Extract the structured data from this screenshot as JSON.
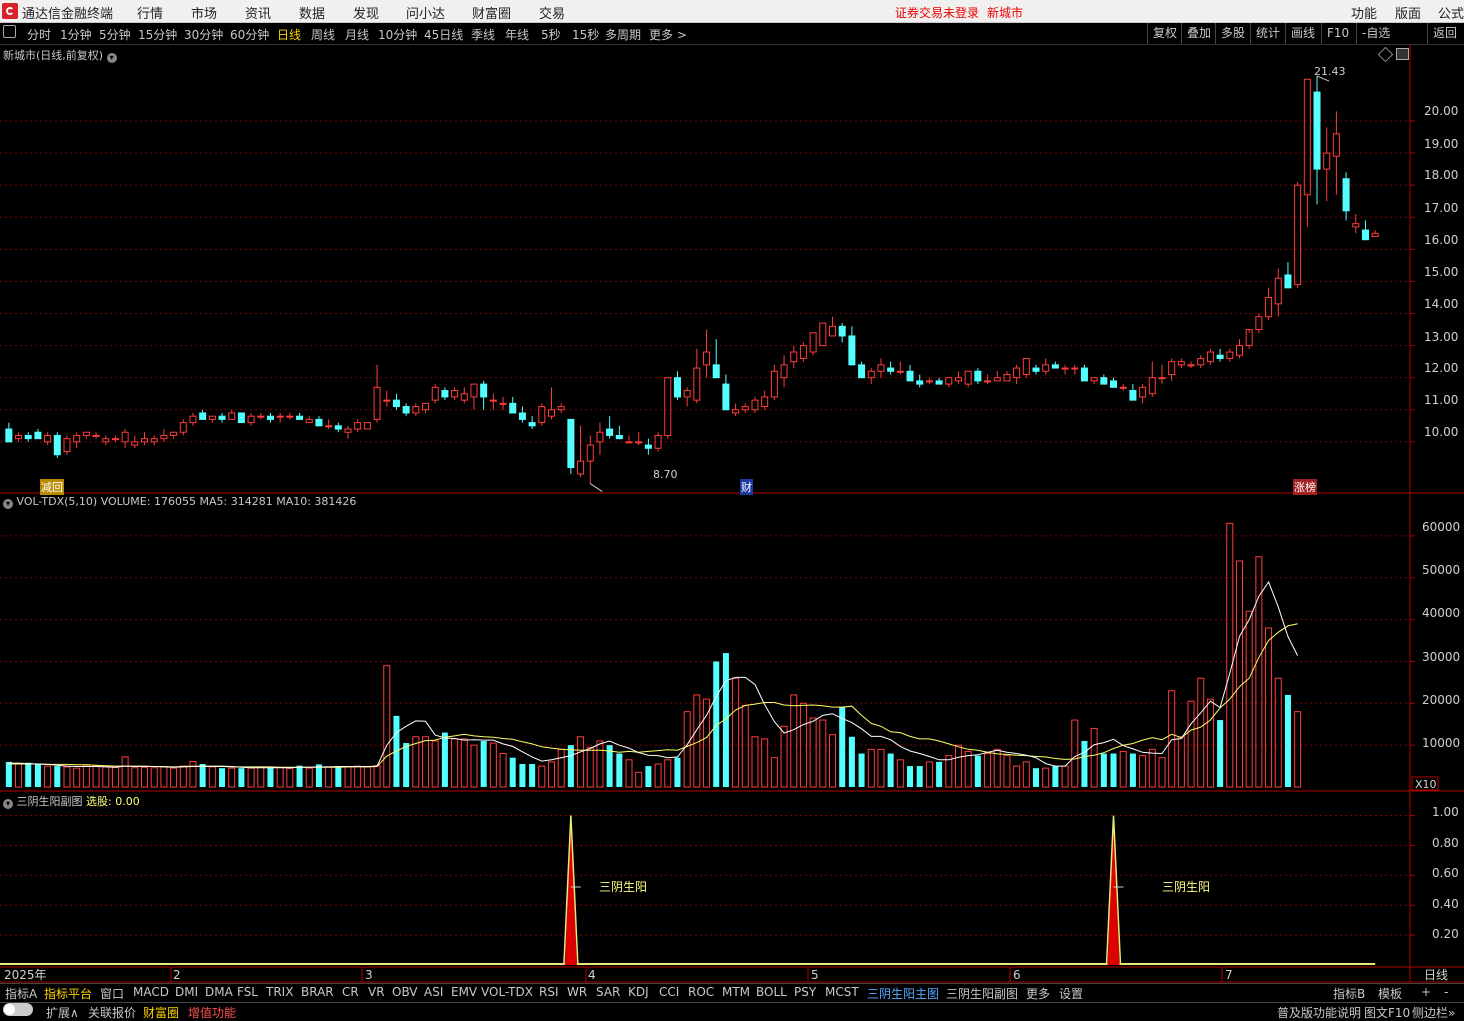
{
  "app": {
    "name": "通达信金融终端",
    "menu": [
      "行情",
      "市场",
      "资讯",
      "数据",
      "发现",
      "问小达",
      "财富圈",
      "交易"
    ],
    "warning": "证券交易未登录",
    "stock_link": "新城市",
    "right_menu": [
      "功能",
      "版面",
      "公式"
    ]
  },
  "periods": [
    "分时",
    "1分钟",
    "5分钟",
    "15分钟",
    "30分钟",
    "60分钟",
    "日线",
    "周线",
    "月线",
    "10分钟",
    "45日线",
    "季线",
    "年线",
    "5秒",
    "15秒",
    "多周期",
    "更多 >"
  ],
  "active_period": "日线",
  "toolbar_right": [
    "复权",
    "叠加",
    "多股",
    "统计",
    "画线",
    "F10",
    "-自选",
    "返回"
  ],
  "main_panel": {
    "title": "新城市(日线,前复权)",
    "high_label": "21.43",
    "low_label": "8.70",
    "tags": [
      "减回",
      "财",
      "涨榜"
    ],
    "y_ticks": [
      "20.00",
      "19.00",
      "18.00",
      "17.00",
      "16.00",
      "15.00",
      "14.00",
      "13.00",
      "12.00",
      "11.00",
      "10.00"
    ]
  },
  "volume_panel": {
    "title": "VOL-TDX(5,10)",
    "volume_label": "VOLUME:",
    "volume": "176055",
    "ma5_label": "MA5:",
    "ma5": "314281",
    "ma10_label": "MA10:",
    "ma10": "381426",
    "y_ticks": [
      "60000",
      "50000",
      "40000",
      "30000",
      "20000",
      "10000"
    ],
    "unit": "X10"
  },
  "indicator_panel": {
    "title": "三阴生阳副图",
    "select_label": "选股:",
    "select_value": "0.00",
    "signal_label": "三阴生阳",
    "y_ticks": [
      "1.00",
      "0.80",
      "0.60",
      "0.40",
      "0.20"
    ]
  },
  "x_axis": {
    "labels": [
      "2025年",
      "2",
      "3",
      "4",
      "5",
      "6",
      "7"
    ],
    "period_label": "日线"
  },
  "indicator_tabs": [
    "指标A",
    "指标平台",
    "窗口",
    "MACD",
    "DMI",
    "DMA",
    "FSL",
    "TRIX",
    "BRAR",
    "CR",
    "VR",
    "OBV",
    "ASI",
    "EMV",
    "VOL-TDX",
    "RSI",
    "WR",
    "SAR",
    "KDJ",
    "CCI",
    "ROC",
    "MTM",
    "BOLL",
    "PSY",
    "MCST",
    "三阴生阳主图",
    "三阴生阳副图",
    "更多",
    "设置"
  ],
  "indicator_tabs_right": [
    "指标B",
    "模板",
    "+",
    "-"
  ],
  "status": {
    "items": [
      "扩展∧",
      "关联报价",
      "财富圈",
      "增值功能"
    ],
    "right": [
      "普及版功能说明",
      "图文F10",
      "侧边栏»"
    ]
  },
  "colors": {
    "up": "#ff3c3c",
    "down": "#54ffff",
    "grid": "#7a0000",
    "axis": "#b00000",
    "ma5": "#ffffff",
    "ma10": "#ffff66",
    "signal": "#e8e87a",
    "active_text": "#ffd200"
  },
  "chart_data": {
    "type": "candlestick",
    "price_range": [
      8.5,
      21.9
    ],
    "volume_range": [
      0,
      65000
    ],
    "signal_range": [
      0,
      1.05
    ],
    "candles": [
      [
        10.4,
        10.6,
        10.2,
        10.0
      ],
      [
        10.1,
        10.3,
        10.0,
        10.2
      ],
      [
        10.2,
        10.3,
        10.0,
        10.1
      ],
      [
        10.3,
        10.4,
        10.1,
        10.1
      ],
      [
        10.0,
        10.3,
        9.9,
        10.2
      ],
      [
        10.2,
        10.3,
        9.5,
        9.6
      ],
      [
        9.7,
        10.2,
        9.6,
        10.1
      ],
      [
        10.0,
        10.3,
        9.8,
        10.2
      ],
      [
        10.2,
        10.3,
        10.1,
        10.3
      ],
      [
        10.2,
        10.3,
        10.1,
        10.2
      ],
      [
        10.0,
        10.2,
        9.9,
        10.1
      ],
      [
        10.1,
        10.2,
        10.0,
        10.1
      ],
      [
        10.0,
        10.4,
        9.8,
        10.3
      ],
      [
        9.9,
        10.2,
        9.8,
        10.0
      ],
      [
        10.0,
        10.3,
        9.9,
        10.1
      ],
      [
        10.0,
        10.2,
        9.9,
        10.1
      ],
      [
        10.1,
        10.4,
        10.0,
        10.2
      ],
      [
        10.2,
        10.3,
        10.1,
        10.3
      ],
      [
        10.3,
        10.7,
        10.2,
        10.6
      ],
      [
        10.6,
        10.9,
        10.5,
        10.8
      ],
      [
        10.9,
        11.0,
        10.7,
        10.7
      ],
      [
        10.7,
        10.8,
        10.6,
        10.8
      ],
      [
        10.8,
        10.9,
        10.6,
        10.7
      ],
      [
        10.7,
        11.0,
        10.7,
        10.9
      ],
      [
        10.9,
        10.9,
        10.6,
        10.6
      ],
      [
        10.6,
        10.9,
        10.5,
        10.8
      ],
      [
        10.8,
        10.9,
        10.7,
        10.8
      ],
      [
        10.8,
        10.9,
        10.6,
        10.7
      ],
      [
        10.8,
        10.9,
        10.6,
        10.8
      ],
      [
        10.8,
        10.9,
        10.7,
        10.8
      ],
      [
        10.8,
        10.9,
        10.7,
        10.7
      ],
      [
        10.6,
        10.8,
        10.6,
        10.7
      ],
      [
        10.7,
        10.8,
        10.5,
        10.5
      ],
      [
        10.5,
        10.7,
        10.4,
        10.5
      ],
      [
        10.5,
        10.6,
        10.3,
        10.4
      ],
      [
        10.3,
        10.5,
        10.1,
        10.4
      ],
      [
        10.4,
        10.7,
        10.3,
        10.6
      ],
      [
        10.4,
        10.6,
        10.4,
        10.6
      ],
      [
        10.7,
        12.4,
        10.6,
        11.7
      ],
      [
        11.3,
        11.6,
        11.1,
        11.3
      ],
      [
        11.3,
        11.5,
        11.0,
        11.1
      ],
      [
        11.1,
        11.2,
        10.8,
        10.9
      ],
      [
        10.9,
        11.2,
        10.8,
        11.1
      ],
      [
        11.0,
        11.2,
        10.9,
        11.2
      ],
      [
        11.3,
        11.8,
        11.2,
        11.7
      ],
      [
        11.6,
        11.7,
        11.3,
        11.4
      ],
      [
        11.4,
        11.7,
        11.3,
        11.6
      ],
      [
        11.3,
        11.7,
        11.2,
        11.5
      ],
      [
        11.4,
        11.8,
        11.0,
        11.8
      ],
      [
        11.8,
        11.9,
        11.0,
        11.4
      ],
      [
        11.3,
        11.5,
        11.0,
        11.3
      ],
      [
        11.2,
        11.4,
        11.0,
        11.2
      ],
      [
        11.2,
        11.4,
        10.9,
        10.9
      ],
      [
        10.9,
        11.1,
        10.6,
        10.7
      ],
      [
        10.6,
        10.8,
        10.4,
        10.5
      ],
      [
        10.6,
        11.2,
        10.5,
        11.1
      ],
      [
        10.8,
        11.7,
        10.7,
        11.0
      ],
      [
        11.0,
        11.2,
        10.9,
        11.1
      ],
      [
        10.7,
        10.7,
        9.0,
        9.2
      ],
      [
        9.0,
        10.5,
        8.9,
        9.4
      ],
      [
        9.4,
        10.2,
        8.7,
        9.9
      ],
      [
        10.0,
        10.6,
        9.6,
        10.3
      ],
      [
        10.4,
        10.8,
        10.1,
        10.2
      ],
      [
        10.2,
        10.5,
        10.1,
        10.1
      ],
      [
        10.0,
        10.2,
        10.0,
        10.0
      ],
      [
        10.0,
        10.3,
        9.9,
        10.0
      ],
      [
        9.9,
        10.1,
        9.6,
        9.8
      ],
      [
        9.8,
        10.3,
        9.7,
        10.2
      ],
      [
        10.2,
        12.0,
        10.1,
        12.0
      ],
      [
        12.0,
        12.2,
        11.3,
        11.4
      ],
      [
        11.4,
        11.7,
        11.1,
        11.6
      ],
      [
        11.3,
        12.9,
        11.2,
        12.3
      ],
      [
        12.4,
        13.5,
        12.0,
        12.8
      ],
      [
        12.4,
        13.2,
        12.1,
        12.0
      ],
      [
        11.8,
        12.1,
        11.0,
        11.0
      ],
      [
        10.9,
        11.2,
        10.8,
        11.0
      ],
      [
        11.0,
        11.2,
        10.9,
        11.1
      ],
      [
        11.0,
        11.4,
        10.9,
        11.3
      ],
      [
        11.1,
        11.6,
        11.0,
        11.4
      ],
      [
        11.4,
        12.4,
        11.3,
        12.2
      ],
      [
        12.0,
        12.7,
        11.7,
        12.4
      ],
      [
        12.5,
        13.0,
        12.3,
        12.8
      ],
      [
        12.6,
        13.1,
        12.5,
        13.0
      ],
      [
        12.8,
        13.4,
        12.7,
        13.4
      ],
      [
        13.0,
        13.7,
        13.0,
        13.7
      ],
      [
        13.3,
        13.9,
        13.3,
        13.6
      ],
      [
        13.6,
        13.7,
        13.1,
        13.3
      ],
      [
        13.3,
        13.6,
        12.7,
        12.4
      ],
      [
        12.4,
        12.5,
        12.0,
        12.0
      ],
      [
        12.0,
        12.3,
        11.8,
        12.2
      ],
      [
        12.2,
        12.6,
        12.0,
        12.4
      ],
      [
        12.3,
        12.5,
        12.1,
        12.2
      ],
      [
        12.2,
        12.5,
        12.1,
        12.2
      ],
      [
        12.2,
        12.4,
        11.9,
        11.9
      ],
      [
        11.9,
        12.1,
        11.7,
        11.8
      ],
      [
        11.9,
        12.0,
        11.8,
        11.9
      ],
      [
        11.9,
        12.0,
        11.8,
        11.8
      ],
      [
        11.8,
        12.0,
        11.7,
        12.0
      ],
      [
        11.9,
        12.2,
        11.8,
        12.0
      ],
      [
        11.8,
        12.2,
        11.7,
        12.2
      ],
      [
        12.2,
        12.3,
        11.8,
        11.9
      ],
      [
        11.9,
        12.1,
        11.8,
        11.9
      ],
      [
        11.9,
        12.2,
        11.9,
        12.0
      ],
      [
        11.9,
        12.2,
        11.9,
        12.1
      ],
      [
        12.0,
        12.4,
        11.8,
        12.3
      ],
      [
        12.1,
        12.6,
        12.0,
        12.6
      ],
      [
        12.3,
        12.4,
        12.1,
        12.2
      ],
      [
        12.2,
        12.6,
        12.1,
        12.4
      ],
      [
        12.4,
        12.5,
        12.3,
        12.3
      ],
      [
        12.3,
        12.4,
        12.1,
        12.3
      ],
      [
        12.3,
        12.4,
        12.1,
        12.3
      ],
      [
        12.3,
        12.4,
        11.9,
        11.9
      ],
      [
        11.9,
        12.0,
        11.8,
        12.0
      ],
      [
        12.0,
        12.1,
        11.8,
        11.8
      ],
      [
        11.9,
        12.0,
        11.7,
        11.7
      ],
      [
        11.7,
        11.8,
        11.6,
        11.7
      ],
      [
        11.6,
        11.8,
        11.3,
        11.3
      ],
      [
        11.4,
        11.8,
        11.2,
        11.7
      ],
      [
        11.5,
        12.5,
        11.4,
        12.0
      ],
      [
        12.0,
        12.4,
        11.8,
        12.0
      ],
      [
        12.1,
        12.6,
        11.9,
        12.5
      ],
      [
        12.4,
        12.6,
        12.3,
        12.5
      ],
      [
        12.4,
        12.5,
        12.3,
        12.4
      ],
      [
        12.4,
        12.7,
        12.3,
        12.6
      ],
      [
        12.5,
        12.9,
        12.4,
        12.8
      ],
      [
        12.7,
        12.9,
        12.5,
        12.6
      ],
      [
        12.6,
        12.9,
        12.5,
        12.8
      ],
      [
        12.7,
        13.2,
        12.6,
        13.0
      ],
      [
        13.0,
        13.4,
        12.9,
        13.5
      ],
      [
        13.5,
        14.0,
        13.4,
        13.9
      ],
      [
        13.9,
        14.8,
        13.8,
        14.5
      ],
      [
        14.3,
        15.4,
        13.9,
        15.1
      ],
      [
        15.2,
        15.6,
        14.8,
        14.8
      ],
      [
        14.9,
        18.1,
        14.8,
        18.0
      ],
      [
        17.7,
        21.3,
        16.7,
        21.3
      ],
      [
        20.9,
        21.4,
        17.4,
        18.5
      ],
      [
        18.5,
        19.8,
        17.5,
        19.0
      ],
      [
        18.9,
        20.3,
        17.7,
        19.6
      ],
      [
        18.2,
        18.4,
        16.9,
        17.2
      ],
      [
        16.7,
        17.1,
        16.5,
        16.8
      ],
      [
        16.6,
        16.9,
        16.3,
        16.3
      ],
      [
        16.4,
        16.6,
        16.4,
        16.5
      ]
    ],
    "volumes": [
      6000,
      5500,
      5800,
      5400,
      5000,
      5000,
      4800,
      4500,
      5200,
      5000,
      5000,
      4700,
      7200,
      4600,
      4700,
      4600,
      4800,
      4500,
      5000,
      6100,
      5500,
      4800,
      4500,
      4500,
      4500,
      4500,
      4800,
      4700,
      4700,
      4400,
      5100,
      4500,
      5400,
      4800,
      4800,
      4800,
      5000,
      4800,
      5100,
      29000,
      17000,
      10500,
      12000,
      12000,
      11000,
      13000,
      11500,
      11500,
      10000,
      11000,
      10500,
      8000,
      7000,
      5500,
      5500,
      5000,
      6000,
      9000,
      10000,
      12000,
      9500,
      11000,
      10000,
      8000,
      6500,
      3500,
      5000,
      5500,
      6500,
      7000,
      18000,
      22000,
      21000,
      30000,
      32000,
      26000,
      19500,
      12000,
      11500,
      7000,
      14500,
      22000,
      20000,
      16500,
      16000,
      12500,
      19000,
      12000,
      8000,
      9000,
      9000,
      8000,
      6500,
      5000,
      5000,
      6000,
      6000,
      7500,
      10000,
      8500,
      7500,
      8000,
      9000,
      7500,
      5000,
      6000,
      4500,
      4500,
      5000,
      5000,
      16000,
      11000,
      14000,
      8000,
      8000,
      8500,
      8000,
      7500,
      9000,
      7000,
      23000,
      12000,
      20500,
      26000,
      21000,
      16000,
      63000,
      54000,
      42000,
      55000,
      38000,
      26000,
      22000,
      18000
    ],
    "ma5": [
      5700,
      5700,
      5600,
      5500,
      5400,
      5200,
      5000,
      4900,
      4900,
      4900,
      4800,
      4700,
      5000,
      4900,
      4900,
      4900,
      4800,
      4700,
      4800,
      4900,
      5000,
      5000,
      5000,
      4900,
      4700,
      4600,
      4600,
      4600,
      4600,
      4600,
      4700,
      4700,
      4800,
      4800,
      4900,
      4900,
      4900,
      4900,
      5000,
      10000,
      13000,
      14500,
      15800,
      15700,
      12400,
      11700,
      11600,
      11200,
      11300,
      11200,
      11200,
      10300,
      9700,
      8400,
      7200,
      6200,
      6500,
      7000,
      7500,
      8400,
      9200,
      10300,
      11000,
      10000,
      9300,
      8200,
      7600,
      7500,
      7000,
      7200,
      10100,
      13700,
      17100,
      21600,
      25400,
      26200,
      26200,
      24500,
      19700,
      15600,
      12900,
      13700,
      14900,
      15700,
      17100,
      17500,
      16400,
      15400,
      13900,
      12100,
      12100,
      11300,
      9700,
      8600,
      8000,
      7300,
      6500,
      6500,
      7100,
      7500,
      7700,
      8300,
      8800,
      8300,
      8000,
      7600,
      7000,
      5600,
      5000,
      5000,
      7300,
      8300,
      10100,
      10600,
      11400,
      9900,
      9100,
      8300,
      8100,
      8000,
      11300,
      11600,
      15100,
      17700,
      20500,
      19000,
      27200,
      36000,
      40000,
      45600,
      49000,
      43000,
      36000,
      31400
    ],
    "ma10": [
      5500,
      5500,
      5500,
      5500,
      5400,
      5400,
      5400,
      5300,
      5300,
      5200,
      5100,
      5000,
      5000,
      5000,
      5000,
      4900,
      4900,
      4800,
      4900,
      5000,
      4900,
      4900,
      4900,
      4800,
      4800,
      4800,
      4800,
      4800,
      4700,
      4700,
      4700,
      4700,
      4700,
      4700,
      4700,
      4800,
      4800,
      4800,
      4900,
      7400,
      8600,
      9700,
      10400,
      11100,
      11200,
      11900,
      12200,
      12600,
      12200,
      12000,
      11900,
      11600,
      11400,
      10800,
      10300,
      9600,
      9300,
      9000,
      8900,
      8800,
      8800,
      8800,
      8600,
      8300,
      8500,
      8300,
      8500,
      8700,
      8900,
      8800,
      9700,
      10600,
      11800,
      14700,
      16300,
      18400,
      19500,
      19800,
      20200,
      20200,
      19600,
      19400,
      19500,
      19600,
      19400,
      19100,
      19100,
      19300,
      17100,
      15200,
      14500,
      13200,
      13000,
      12100,
      11500,
      11500,
      11000,
      10300,
      9600,
      9000,
      8800,
      8300,
      7900,
      7800,
      7600,
      7500,
      7300,
      7200,
      6800,
      6600,
      6700,
      7300,
      7600,
      8200,
      9200,
      10000,
      10400,
      11200,
      11800,
      11300,
      12600,
      11800,
      13600,
      14300,
      16000,
      18900,
      21000,
      24000,
      26000,
      31000,
      35000,
      37000,
      38500,
      39000
    ],
    "signals": [
      {
        "index": 58,
        "value": 1.0
      },
      {
        "index": 114,
        "value": 1.0
      }
    ]
  }
}
